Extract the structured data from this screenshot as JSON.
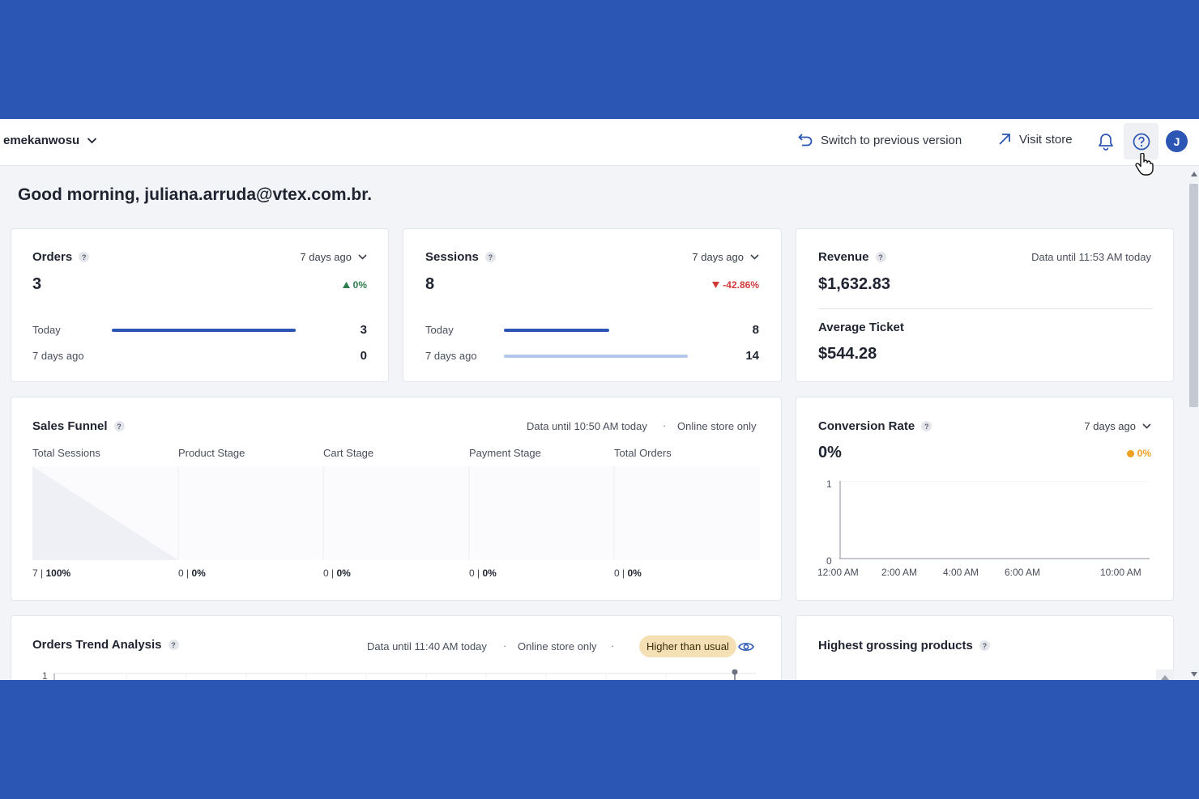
{
  "topbar": {
    "account": "emekanwosu",
    "switch_label": "Switch to previous version",
    "visit_label": "Visit store",
    "avatar_initial": "J"
  },
  "greeting": "Good morning, juliana.arruda@vtex.com.br.",
  "orders": {
    "title": "Orders",
    "help": "?",
    "period": "7 days ago",
    "value": "3",
    "delta": "0%",
    "rows": [
      {
        "label": "Today",
        "value": "3"
      },
      {
        "label": "7 days ago",
        "value": "0"
      }
    ]
  },
  "sessions": {
    "title": "Sessions",
    "help": "?",
    "period": "7 days ago",
    "value": "8",
    "delta": "-42.86%",
    "rows": [
      {
        "label": "Today",
        "value": "8"
      },
      {
        "label": "7 days ago",
        "value": "14"
      }
    ]
  },
  "revenue": {
    "title": "Revenue",
    "help": "?",
    "meta": "Data until 11:53 AM today",
    "value": "$1,632.83",
    "avg_title": "Average Ticket",
    "avg_value": "$544.28"
  },
  "funnel": {
    "title": "Sales Funnel",
    "help": "?",
    "meta": "Data until 10:50 AM today",
    "dot": "·",
    "scope": "Online store only",
    "stages": [
      {
        "label": "Total Sessions",
        "count": "7 |",
        "pct": "100%"
      },
      {
        "label": "Product Stage",
        "count": "0 |",
        "pct": "0%"
      },
      {
        "label": "Cart Stage",
        "count": "0 |",
        "pct": "0%"
      },
      {
        "label": "Payment Stage",
        "count": "0 |",
        "pct": "0%"
      },
      {
        "label": "Total Orders",
        "count": "0 |",
        "pct": "0%"
      }
    ]
  },
  "conversion": {
    "title": "Conversion Rate",
    "help": "?",
    "period": "7 days ago",
    "value": "0%",
    "delta": "0%",
    "y_ticks": [
      "1",
      "0"
    ],
    "x_ticks": [
      "12:00 AM",
      "2:00 AM",
      "4:00 AM",
      "6:00 AM",
      "10:00 AM"
    ]
  },
  "trend": {
    "title": "Orders Trend Analysis",
    "help": "?",
    "meta": "Data until 11:40 AM today",
    "dot1": "·",
    "scope": "Online store only",
    "dot2": "·",
    "badge": "Higher than usual",
    "y_tick": "1"
  },
  "products": {
    "title": "Highest grossing products",
    "help": "?"
  },
  "colors": {
    "brand_blue": "#2c56b4",
    "bar_dark": "#2c56b4",
    "bar_light": "#b3c6ec",
    "positive": "#2f7d4f",
    "negative": "#d23a3a",
    "warning": "#f0a020",
    "badge_bg": "#f5dfb4"
  }
}
